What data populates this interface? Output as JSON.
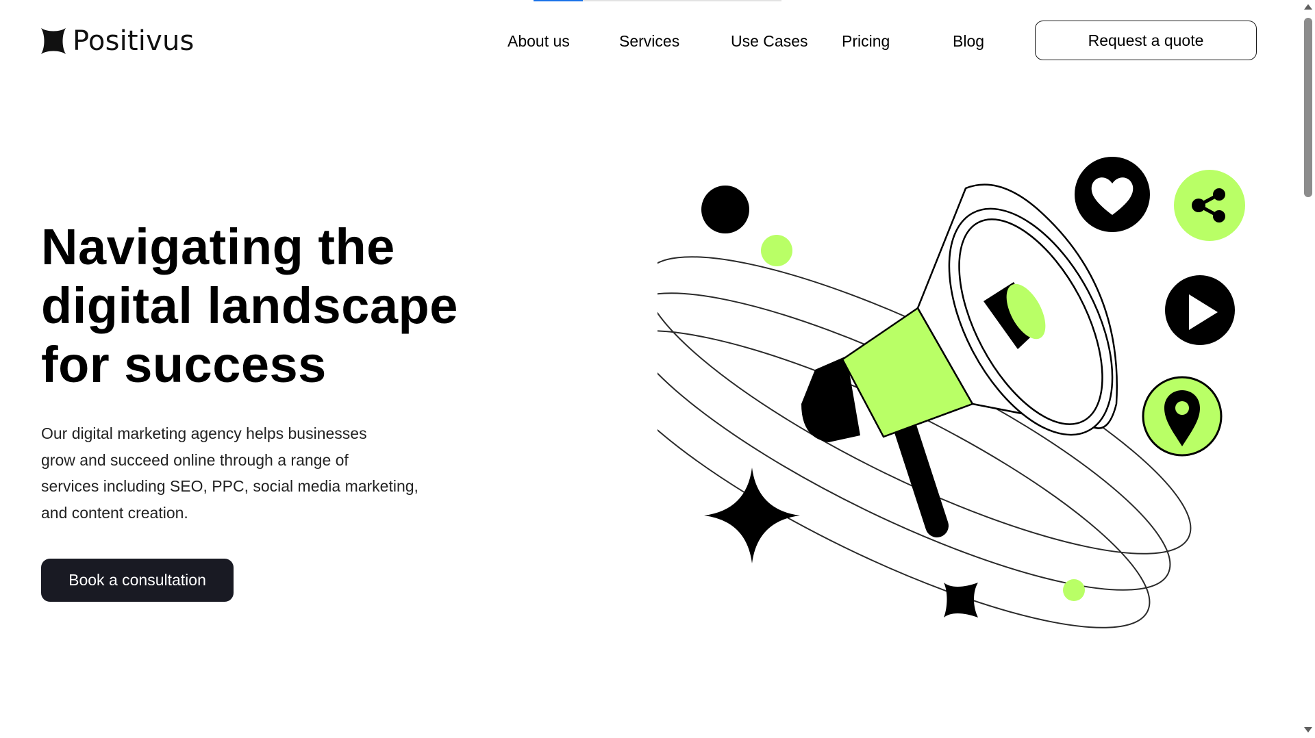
{
  "brand": {
    "name": "Positivus",
    "logo_icon": "four-point-star-logo-icon"
  },
  "nav": {
    "items": [
      {
        "label": "About us"
      },
      {
        "label": "Services"
      },
      {
        "label": "Use Cases"
      },
      {
        "label": "Pricing"
      },
      {
        "label": "Blog"
      }
    ],
    "cta_label": "Request a quote"
  },
  "hero": {
    "title_lines": [
      "Navigating the",
      "digital landscape",
      "for success"
    ],
    "description_lines": [
      "Our digital marketing agency helps businesses",
      "grow and succeed online through a range of",
      "services including SEO, PPC, social media marketing,",
      "and content creation."
    ],
    "cta_label": "Book a consultation"
  },
  "illustration": {
    "icons": [
      "megaphone-icon",
      "heart-icon",
      "share-icon",
      "play-icon",
      "location-pin-icon",
      "sparkle-star-icon"
    ]
  },
  "colors": {
    "accent": "#B9FF66",
    "dark": "#191A23",
    "text": "#000000",
    "background": "#FFFFFF",
    "progress": "#1A73E8"
  },
  "reading_progress": 0.2
}
